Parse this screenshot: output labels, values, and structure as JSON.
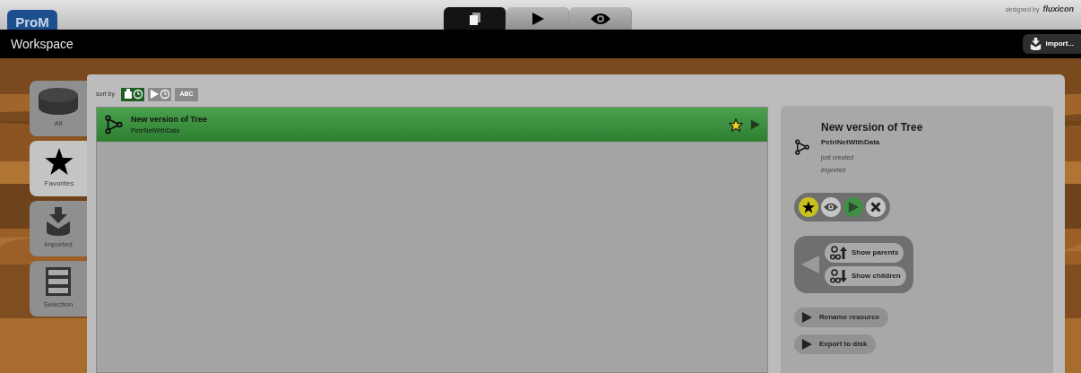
{
  "header": {
    "logo": "ProM",
    "designed_by": "designed by",
    "brand": "fluxicon",
    "title": "Workspace",
    "import_button": "import..."
  },
  "top_tabs": [
    {
      "kind": "resources",
      "selected": true
    },
    {
      "kind": "actions",
      "selected": false
    },
    {
      "kind": "views",
      "selected": false
    }
  ],
  "sidebar": {
    "items": [
      {
        "kind": "all",
        "label": "All",
        "selected": false
      },
      {
        "kind": "favorites",
        "label": "Favorites",
        "selected": true
      },
      {
        "kind": "imported",
        "label": "Imported",
        "selected": false
      },
      {
        "kind": "selection",
        "label": "Selection",
        "selected": false
      }
    ]
  },
  "sort": {
    "label": "sort by",
    "buttons": [
      {
        "kind": "created",
        "selected": true
      },
      {
        "kind": "used",
        "selected": false
      },
      {
        "kind": "alpha",
        "label": "ABC",
        "selected": false
      }
    ]
  },
  "resources": [
    {
      "name": "New version of Tree",
      "type": "PetriNetWithData",
      "selected": true,
      "favorite": true
    }
  ],
  "detail": {
    "title": "New version of Tree",
    "type": "PetriNetWithData",
    "status": "just created",
    "origin": "imported",
    "actions": [
      {
        "kind": "favorite",
        "on": true
      },
      {
        "kind": "view",
        "on": false
      },
      {
        "kind": "play",
        "on": true
      },
      {
        "kind": "delete",
        "on": false
      }
    ],
    "relations": [
      {
        "kind": "parents",
        "label": "Show parents"
      },
      {
        "kind": "children",
        "label": "Show children"
      }
    ],
    "commands": [
      "Rename resource",
      "Export to disk"
    ]
  }
}
